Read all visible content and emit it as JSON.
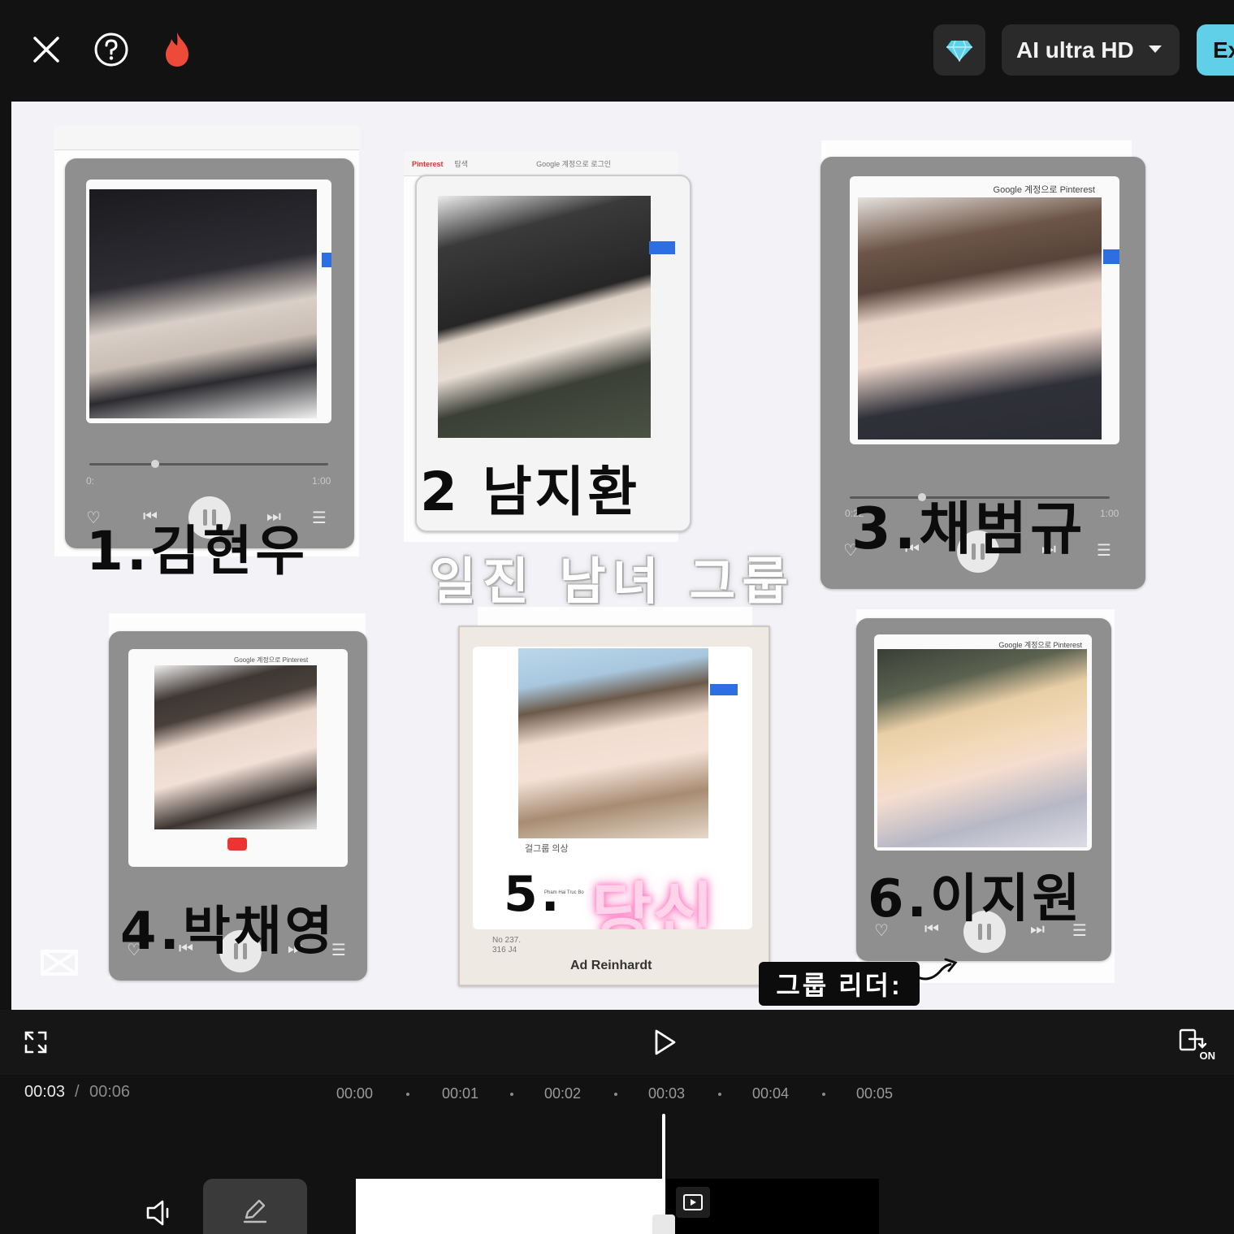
{
  "topbar": {
    "icons": {
      "close": "close-icon",
      "help": "help-icon",
      "fire": "fire-icon",
      "premium": "diamond-icon"
    },
    "quality_label": "AI ultra HD",
    "export_label": "Ex"
  },
  "canvas": {
    "title_sticker": "일진 남녀 그룹",
    "leader_label": "그룹 리더:",
    "cards": [
      {
        "caption": "1.김현우",
        "time_start": "0:",
        "time_end": "1:00"
      },
      {
        "caption": "2 남지환"
      },
      {
        "caption": "3.채범규",
        "time_start": "0:22",
        "time_end": "1:00"
      },
      {
        "caption": "4.박채영"
      },
      {
        "caption": "5.",
        "highlight": "당신",
        "tag": "걸그룹 의상",
        "tag2": "Pham Hai Truc Bo",
        "note": "Ad Reinhardt",
        "stamp": "No 237. 316 J4"
      },
      {
        "caption": "6.이지원"
      }
    ],
    "pinterest_texts": [
      "Google 계정으로 Pinterest",
      "Google 계정으로 로그인",
      "Pinterest",
      "탐색"
    ],
    "colors": {
      "canvas_bg": "#f3f2f7",
      "card_gray": "#8f8f8f",
      "accent_blue": "#2d6fe0",
      "pink_glow": "#ff5fb3"
    }
  },
  "player": {
    "icons": {
      "fullscreen": "fullscreen-icon",
      "play": "play-icon",
      "compare": "compare-on-icon"
    },
    "compare_label": "ON"
  },
  "timeline": {
    "current_time": "00:03",
    "separator": "/",
    "total_time": "00:06",
    "ruler": [
      "00:00",
      "00:01",
      "00:02",
      "00:03",
      "00:04",
      "00:05"
    ],
    "icons": {
      "volume": "volume-icon",
      "edit": "pencil-icon",
      "clip": "clip-play-icon"
    }
  }
}
